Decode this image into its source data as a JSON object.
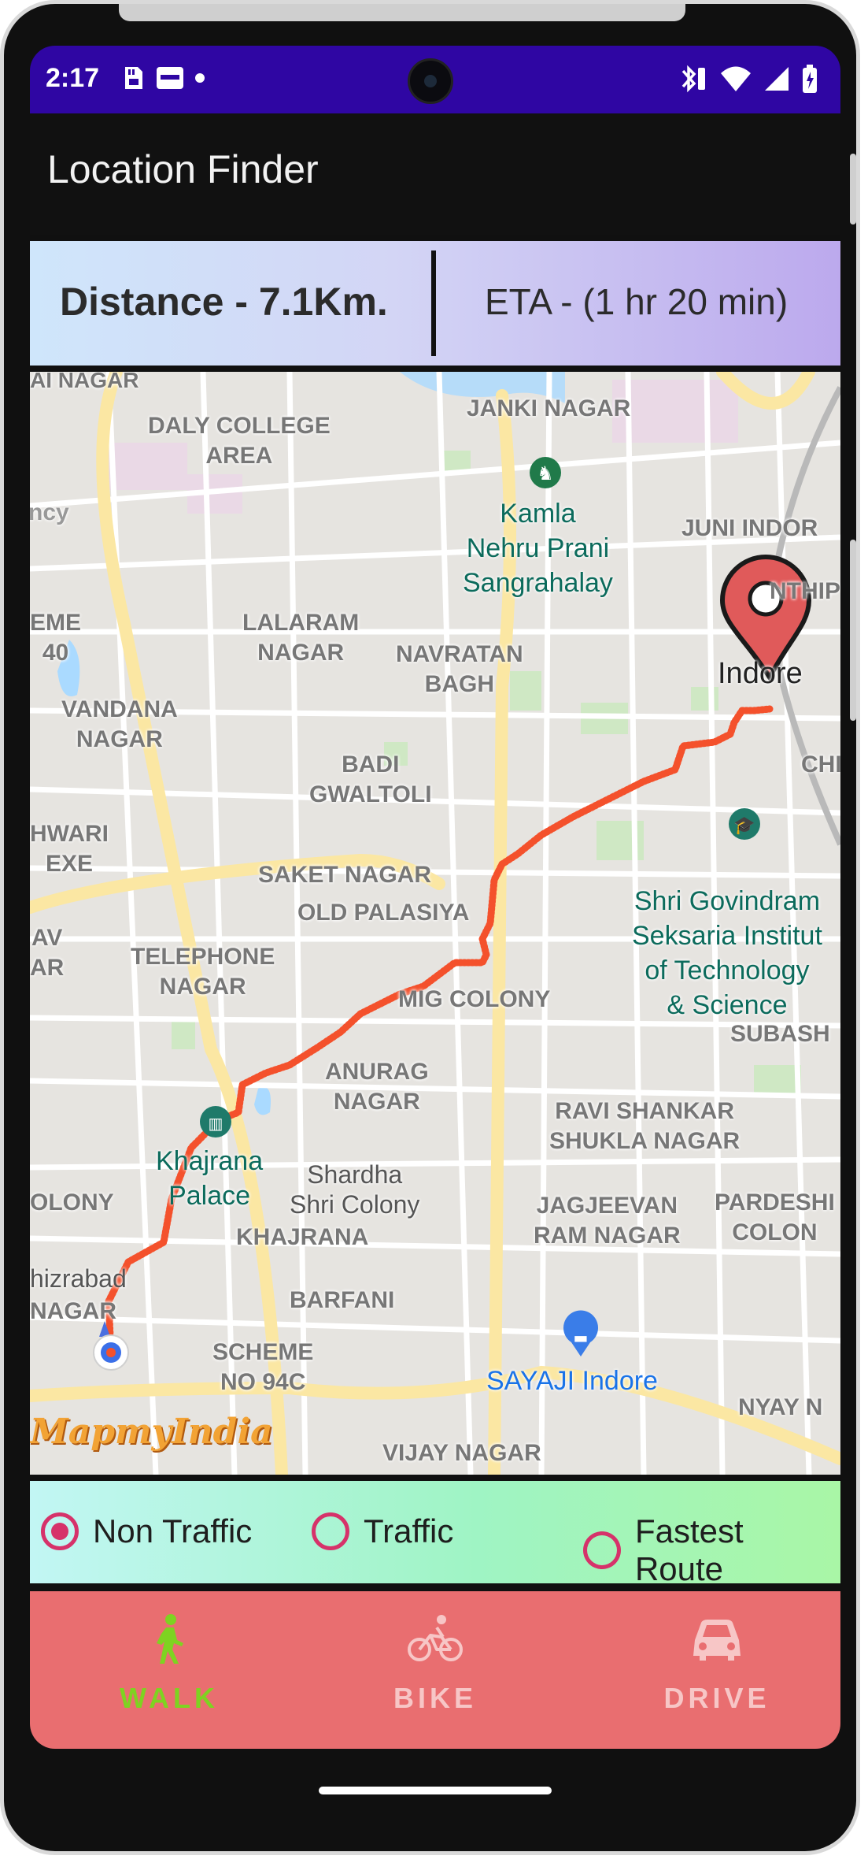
{
  "status_bar": {
    "time": "2:17",
    "left_icons": [
      "sd-card-icon",
      "paytm-icon",
      "dot-icon"
    ],
    "right_icons": [
      "bluetooth-battery-icon",
      "wifi-icon",
      "signal-icon",
      "battery-icon"
    ]
  },
  "app_bar": {
    "title": "Location Finder"
  },
  "info": {
    "distance": "Distance - 7.1Km.",
    "eta": "ETA - (1 hr 20 min)"
  },
  "map": {
    "labels": {
      "janki_nagar": "JANKI NAGAR",
      "daly_college_1": "DALY COLLEGE",
      "daly_college_2": "AREA",
      "kamla_1": "Kamla",
      "kamla_2": "Nehru Prani",
      "kamla_3": "Sangrahalay",
      "juni_indore": "JUNI INDOR",
      "lalaram_1": "LALARAM",
      "lalaram_2": "NAGAR",
      "navratan_1": "NAVRATAN",
      "navratan_2": "BAGH",
      "indore": "Indore",
      "vandana_1": "VANDANA",
      "vandana_2": "NAGAR",
      "badi_1": "BADI",
      "badi_2": "GWALTOLI",
      "hwari": "HWARI",
      "exe": "EXE",
      "saket": "SAKET NAGAR",
      "shri_1": "Shri Govindram",
      "shri_2": "Seksaria Institut",
      "shri_3": "of Technology",
      "shri_4": "& Science",
      "old_palasia": "OLD PALASIYA",
      "telephone_1": "TELEPHONE",
      "telephone_2": "NAGAR",
      "mig": "MIG COLONY",
      "subash": "SUBASH",
      "anurag_1": "ANURAG",
      "anurag_2": "NAGAR",
      "ravi_1": "RAVI SHANKAR",
      "ravi_2": "SHUKLA NAGAR",
      "khajrana_p1": "Khajrana",
      "khajrana_p2": "Palace",
      "shardha_1": "Shardha",
      "shardha_2": "Shri Colony",
      "olony": "OLONY",
      "jagjeevan_1": "JAGJEEVAN",
      "jagjeevan_2": "RAM NAGAR",
      "pardeshi_1": "PARDESHI",
      "pardeshi_2": "COLON",
      "khajrana": "KHAJRANA",
      "khizrabad": "hizrabad",
      "nagar_left": "NAGAR",
      "barfani": "BARFANI",
      "scheme_1": "SCHEME",
      "scheme_2": "NO 94C",
      "sayaji": "SAYAJI Indore",
      "nyay": "NYAY N",
      "vijay": "VIJAY NAGAR",
      "ency": "ncy",
      "eme": "EME",
      "forty": "40",
      "av": "AV",
      "ar": "AR",
      "top_nagar": "AI NAGAR",
      "chi": "CHI",
      "nthip": "NTHIP"
    },
    "watermark": "MapmyIndia"
  },
  "route_options": {
    "selected": "Non Traffic",
    "items": [
      {
        "label": "Non Traffic",
        "checked": true
      },
      {
        "label": "Traffic",
        "checked": false
      },
      {
        "label": "Fastest Route",
        "checked": false
      }
    ]
  },
  "bottom_nav": {
    "items": [
      {
        "label": "WALK",
        "icon": "walk-icon",
        "active": true
      },
      {
        "label": "BIKE",
        "icon": "bike-icon",
        "active": false
      },
      {
        "label": "DRIVE",
        "icon": "car-icon",
        "active": false
      }
    ],
    "active_color": "#7ed321",
    "inactive_color": "#f7c6c6",
    "background": "#e96e70"
  },
  "colors": {
    "status_bar": "#2f06a3",
    "route": "#f4512c",
    "radio": "#d6326a",
    "poi": "#0c6b5c"
  }
}
